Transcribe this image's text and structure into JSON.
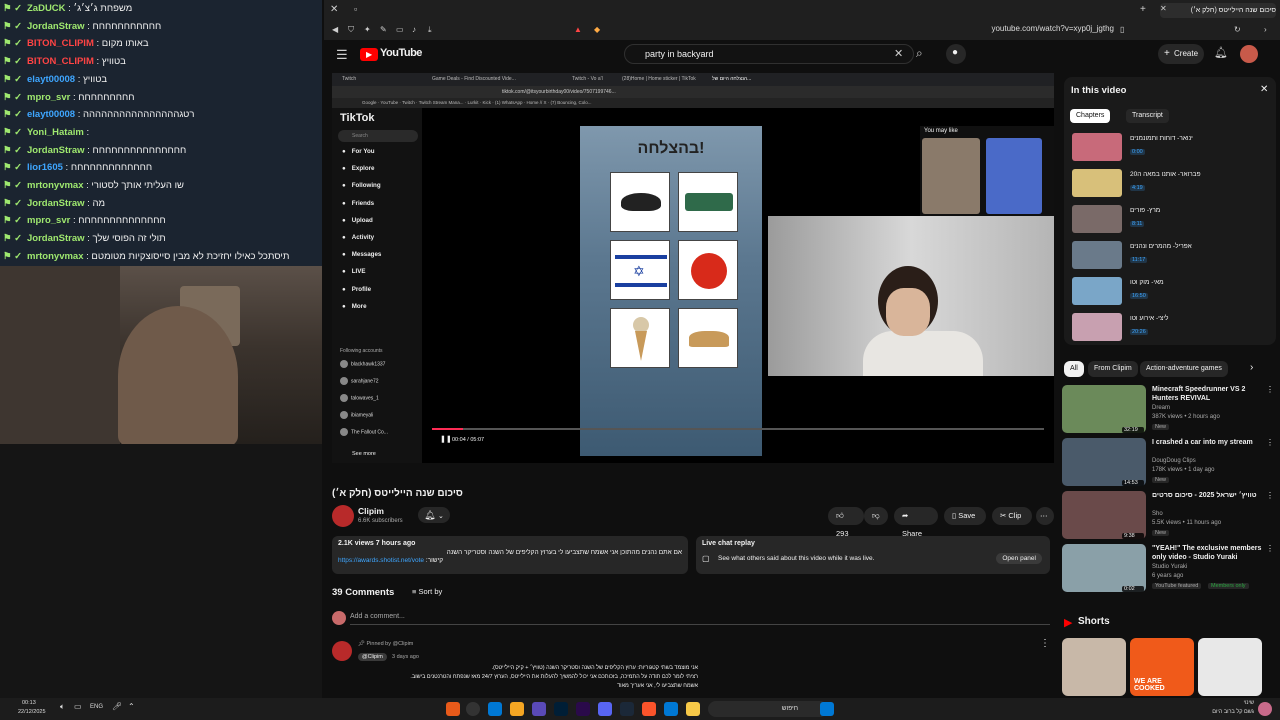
{
  "chat": {
    "lines": [
      {
        "user": "ZaDUCK",
        "msg": "משפחת ג׳צ׳ג׳",
        "color": "#9fe86f"
      },
      {
        "user": "JordanStraw",
        "msg": "חחחחחחחחחחח",
        "color": "#9fe86f"
      },
      {
        "user": "BITON_CLIPIM",
        "msg": "באותו מקום",
        "color": "#ff4444"
      },
      {
        "user": "BITON_CLIPIM",
        "msg": "בטוויץ",
        "color": "#ff4444"
      },
      {
        "user": "elayt00008",
        "msg": "בטוויץ",
        "color": "#3ea6ff"
      },
      {
        "user": "mpro_svr",
        "msg": "חחחחחחחחח",
        "color": "#9fe86f"
      },
      {
        "user": "elayt00008",
        "msg": "רטגהההההההההההההההה",
        "color": "#3ea6ff"
      },
      {
        "user": "Yoni_Hataim",
        "msg": "",
        "color": "#9fe86f"
      },
      {
        "user": "JordanStraw",
        "msg": "חחחחחחחחחחחחחחח",
        "color": "#9fe86f"
      },
      {
        "user": "lior1605",
        "msg": "חחחחחחחחחחחחח",
        "color": "#3ea6ff"
      },
      {
        "user": "mrtonyvmax",
        "msg": "שו העליתי אותך לסטורי",
        "color": "#9fe86f"
      },
      {
        "user": "JordanStraw",
        "msg": "מה",
        "color": "#9fe86f"
      },
      {
        "user": "mpro_svr",
        "msg": "חחחחחחחחחחחחחח",
        "color": "#9fe86f"
      },
      {
        "user": "JordanStraw",
        "msg": "תולי זה הפוסי שלך",
        "color": "#9fe86f"
      },
      {
        "user": "mrtonyvmax",
        "msg": "תיסתכל כאילו יחזיכת לא מבין סייסוצקיות מטומטם",
        "color": "#9fe86f"
      }
    ]
  },
  "browser": {
    "tab_title": "סיכום שנה היילייטס (חלק א׳)",
    "url": "youtube.com/watch?v=xyp0j_jgthg"
  },
  "youtube": {
    "logo": "YouTube",
    "search_value": "party in backyard",
    "create_label": "Create",
    "video_title": "סיכום שנה היילייטס (חלק א׳)",
    "channel_name": "Clipim",
    "subscribers": "6.6K subscribers",
    "likes": "293",
    "share_label": "Share",
    "save_label": "Save",
    "clip_label": "Clip",
    "desc_stats": "2.1K views  7 hours ago",
    "desc_text": "אם אתם נהנים מהתוכן אני אשמח שתצביעו לי בערוץ הקליפים של השנה וסטריקר השנה",
    "desc_link": "https://awards.shotist.net/vote",
    "desc_link_suffix": " :קישור",
    "live_chat_title": "Live chat replay",
    "live_chat_text": "See what others said about this video while it was live.",
    "open_panel": "Open panel",
    "comments_count": "39 Comments",
    "sort_by": "Sort by",
    "add_comment": "Add a comment...",
    "pinned_by": "Pinned by @Clipim",
    "comment_author": "@Clipim",
    "comment_time": "3 days ago",
    "comment_lines": [
      "אני מוצמד בשתי קטגוריות: ערוץ הקליפים של השנה וסטריקר השנה (טוויץ׳ + קיק היילייטס).",
      "רציתי לומר לכם תודה על התמיכה, בזכותכם אני יכול להמשיך להעלות את היילייטס, הערוץ 24/7 מאז שנפתח והטרנטנים בישוב.",
      "אשמח שתצביעו לי, אני אעריך מאוד"
    ]
  },
  "inner_video": {
    "tiktok_menu": [
      "For You",
      "Explore",
      "Following",
      "Friends",
      "Upload",
      "Activity",
      "Messages",
      "LIVE",
      "Profile",
      "More"
    ],
    "following_title": "Following accounts",
    "following": [
      "blackhawk1337",
      "sarahjane72",
      "talowaves_1",
      "ibiameyali",
      "The Fallout Co..."
    ],
    "see_more": "See more",
    "sea_title": "בהצלחה!",
    "may_like": "You may like",
    "time": "00:04 / 05:07",
    "progress": 0.05,
    "tiktok_logo": "TikTok",
    "search_placeholder": "Search"
  },
  "panel": {
    "title": "In this video",
    "tabs": [
      "Chapters",
      "Transcript"
    ],
    "chapters": [
      {
        "title": "ינואר- דוחות ותמונמנים",
        "time": "0:00",
        "color": "#c86a7a"
      },
      {
        "title": "פברואר- אותנו במאה ה20",
        "time": "4:19",
        "color": "#d8c07a"
      },
      {
        "title": "מרץ- פורים",
        "time": "8:11",
        "color": "#7a6a68"
      },
      {
        "title": "אפריל- מהמרים ונהנים",
        "time": "11:17",
        "color": "#6a7a8a"
      },
      {
        "title": "מאי- מוק וטו",
        "time": "16:50",
        "color": "#7aa6c8"
      },
      {
        "title": "ליצי- אירוע וטו",
        "time": "20:26",
        "color": "#c8a0b0"
      }
    ]
  },
  "filters": [
    "All",
    "From Clipim",
    "Action-adventure games"
  ],
  "recs": [
    {
      "title": "Minecraft Speedrunner VS 2 Hunters REVIVAL",
      "channel": "Dream",
      "views": "387K views • 2 hours ago",
      "badge": "New",
      "dur": "32:19",
      "color": "#6b8a5a"
    },
    {
      "title": "I crashed a car into my stream",
      "channel": "DougDoug Clips",
      "views": "178K views • 1 day ago",
      "badge": "New",
      "dur": "14:53",
      "color": "#4a5a6a"
    },
    {
      "title": "טוויץ׳ ישראל 2025 - סיכום סרטים",
      "channel": "Sho",
      "views": "5.5K views • 11 hours ago",
      "badge": "New",
      "dur": "9:38",
      "color": "#6a4a4a"
    },
    {
      "title": "\"YEAH!\" The exclusive members only video - Studio Yuraki",
      "channel": "Studio Yuraki",
      "views": "6 years ago",
      "badge": "YouTube featured",
      "members": "Members only",
      "dur": "0:02",
      "color": "#8aa0a8"
    }
  ],
  "shorts_title": "Shorts",
  "shorts_overlay": "WE ARE COOKED",
  "taskbar": {
    "time": "00:13",
    "date": "22/12/2025",
    "lang": "ENG",
    "search": "חיפוש",
    "weather": "שינוי",
    "weather2": "גשם קל ברוב היום"
  },
  "colors": {
    "accent": "#3ea6ff",
    "yt_red": "#ff0000",
    "tiktok_pink": "#fe2c55"
  }
}
